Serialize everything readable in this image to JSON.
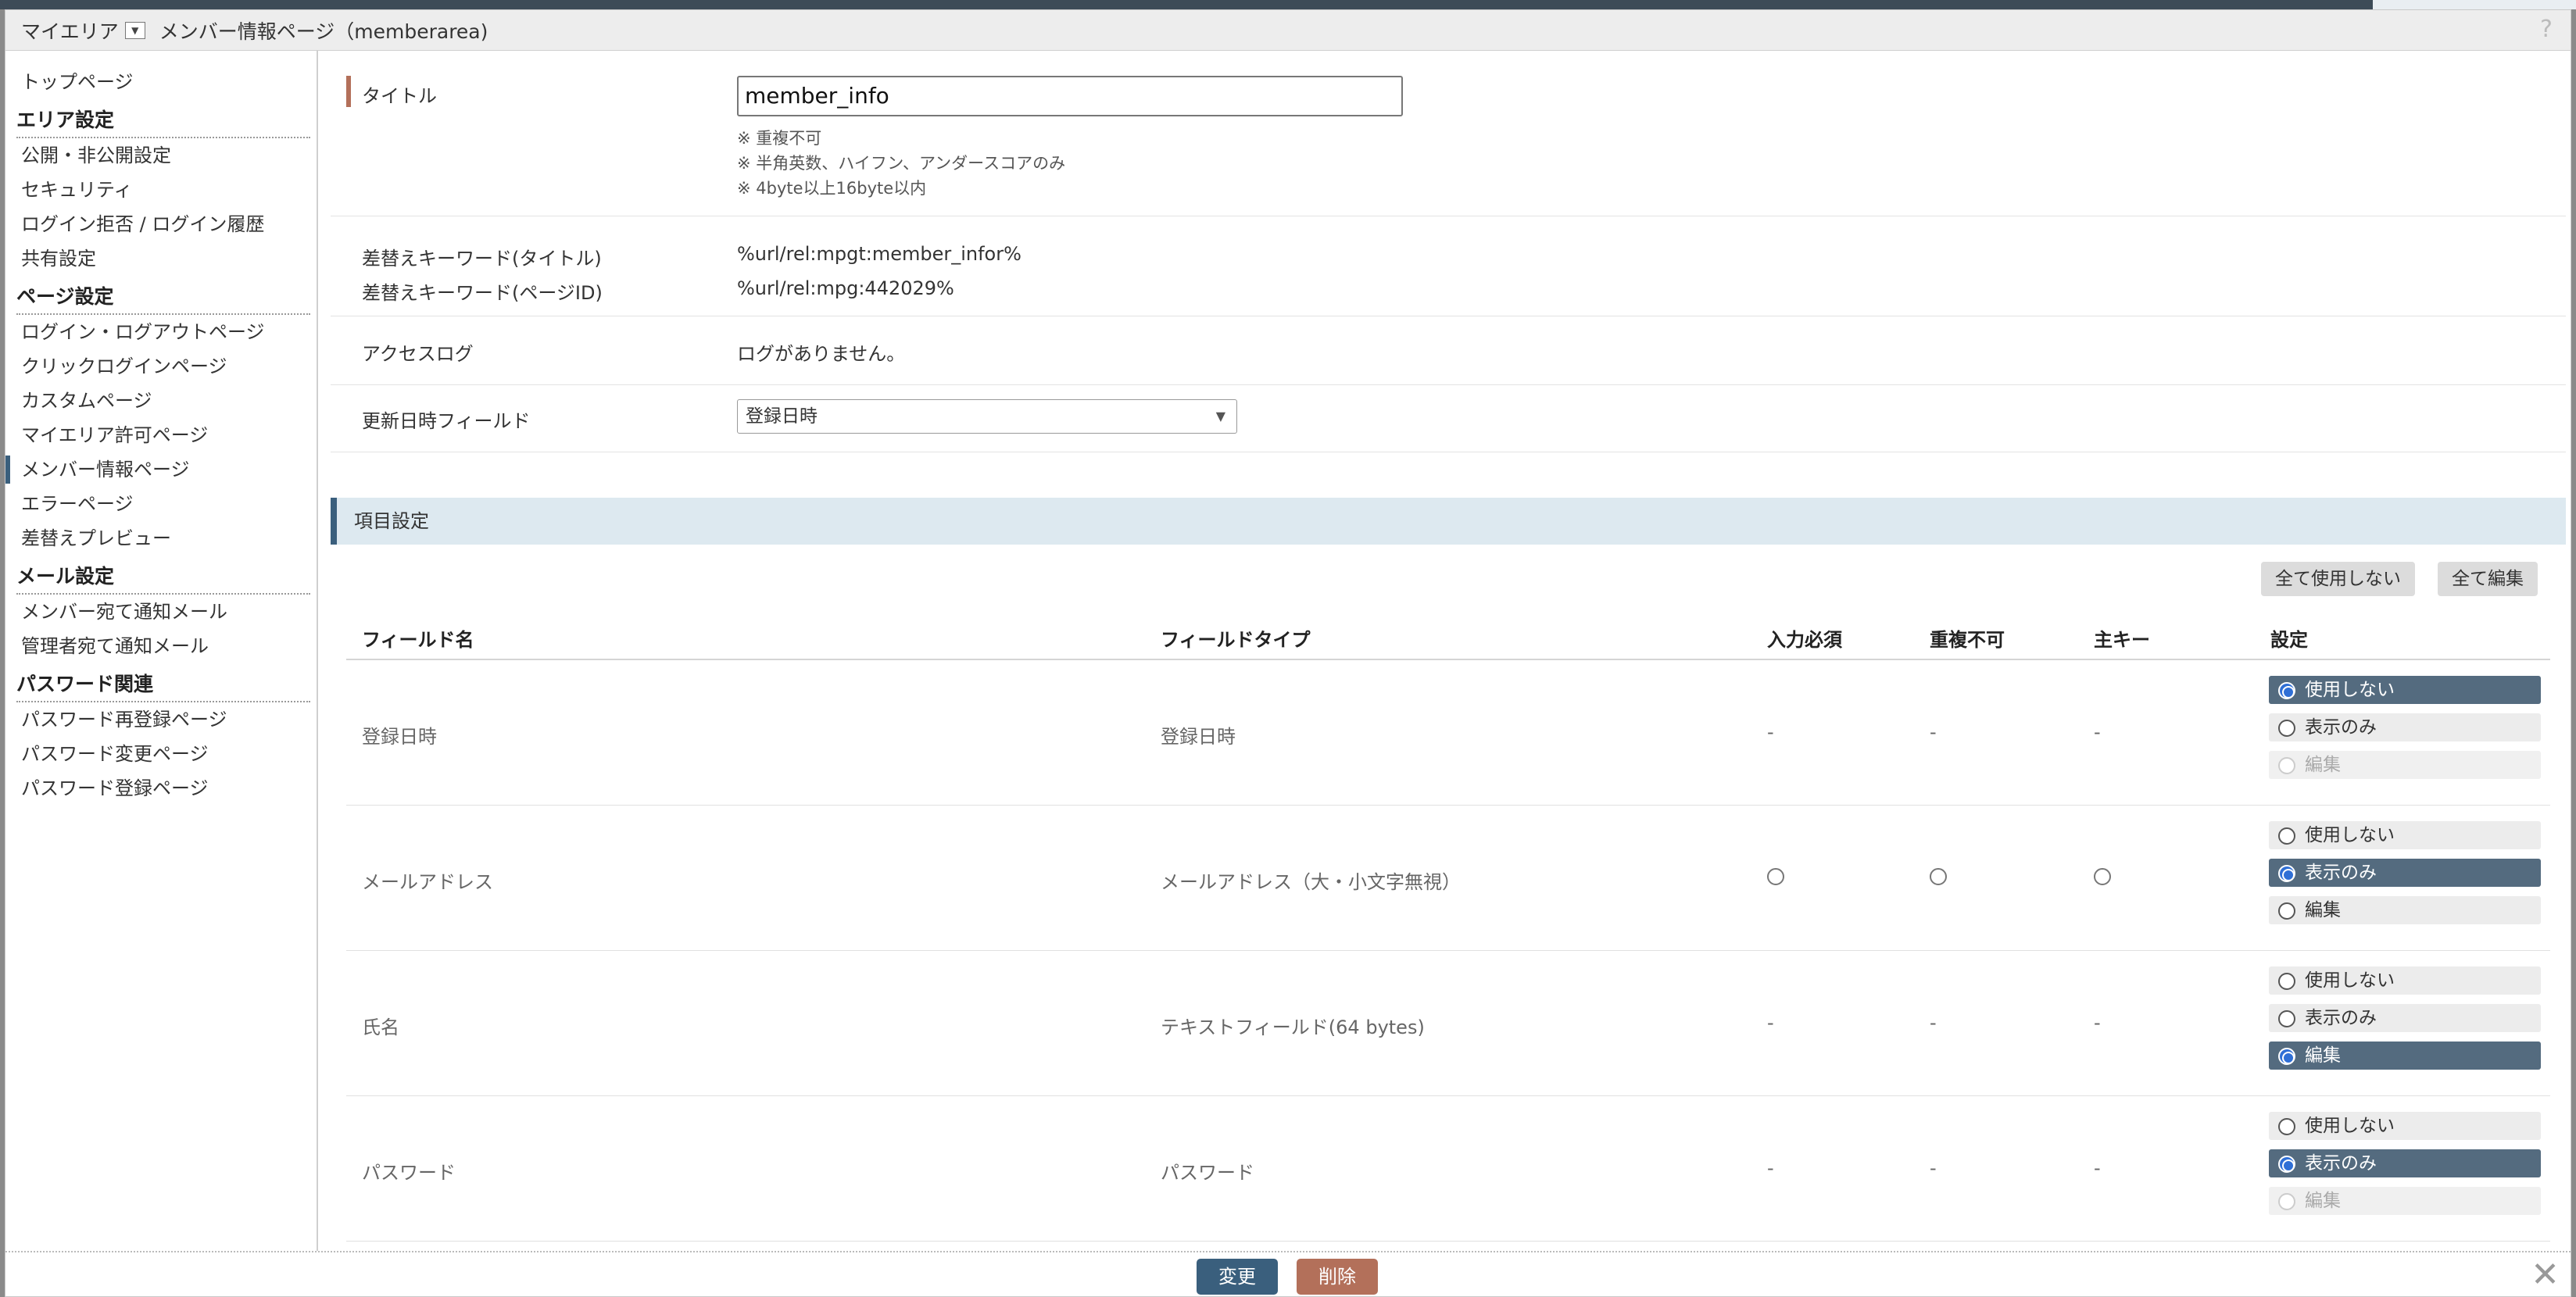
{
  "header": {
    "area_label": "マイエリア",
    "page_title": "メンバー情報ページ（memberarea)",
    "help": "?"
  },
  "sidebar": {
    "top": "トップページ",
    "sections": [
      {
        "title": "エリア設定",
        "items": [
          "公開・非公開設定",
          "セキュリティ",
          "ログイン拒否 / ログイン履歴",
          "共有設定"
        ]
      },
      {
        "title": "ページ設定",
        "items": [
          "ログイン・ログアウトページ",
          "クリックログインページ",
          "カスタムページ",
          "マイエリア許可ページ",
          "メンバー情報ページ",
          "エラーページ",
          "差替えプレビュー"
        ]
      },
      {
        "title": "メール設定",
        "items": [
          "メンバー宛て通知メール",
          "管理者宛て通知メール"
        ]
      },
      {
        "title": "パスワード関連",
        "items": [
          "パスワード再登録ページ",
          "パスワード変更ページ",
          "パスワード登録ページ"
        ]
      }
    ],
    "active": "メンバー情報ページ"
  },
  "form": {
    "title_label": "タイトル",
    "title_value": "member_info",
    "notes": [
      "※ 重複不可",
      "※ 半角英数、ハイフン、アンダースコアのみ",
      "※ 4byte以上16byte以内"
    ],
    "kw_title_label": "差替えキーワード(タイトル)",
    "kw_title_value": "%url/rel:mpgt:member_infor%",
    "kw_id_label": "差替えキーワード(ページID)",
    "kw_id_value": "%url/rel:mpg:442029%",
    "access_log_label": "アクセスログ",
    "access_log_value": "ログがありません。",
    "update_field_label": "更新日時フィールド",
    "update_field_value": "登録日時"
  },
  "items": {
    "section_title": "項目設定",
    "btn_all_unused": "全て使用しない",
    "btn_all_edit": "全て編集",
    "columns": [
      "フィールド名",
      "フィールドタイプ",
      "入力必須",
      "重複不可",
      "主キー",
      "設定"
    ],
    "options": [
      "使用しない",
      "表示のみ",
      "編集"
    ],
    "rows": [
      {
        "name": "登録日時",
        "type": "登録日時",
        "required": "-",
        "unique": "-",
        "primary": "-",
        "selected": 0,
        "disabled": [
          2
        ]
      },
      {
        "name": "メールアドレス",
        "type": "メールアドレス（大・小文字無視）",
        "required": "circle",
        "unique": "circle",
        "primary": "circle",
        "selected": 1,
        "disabled": []
      },
      {
        "name": "氏名",
        "type": "テキストフィールド(64 bytes)",
        "required": "-",
        "unique": "-",
        "primary": "-",
        "selected": 2,
        "disabled": []
      },
      {
        "name": "パスワード",
        "type": "パスワード",
        "required": "-",
        "unique": "-",
        "primary": "-",
        "selected": 1,
        "disabled": [
          2
        ]
      }
    ]
  },
  "footer": {
    "change": "変更",
    "delete": "削除",
    "close": "✕"
  },
  "colors": {
    "primary": "#3a5f7d",
    "danger": "#b3705a",
    "selected_option": "#546b7f"
  }
}
